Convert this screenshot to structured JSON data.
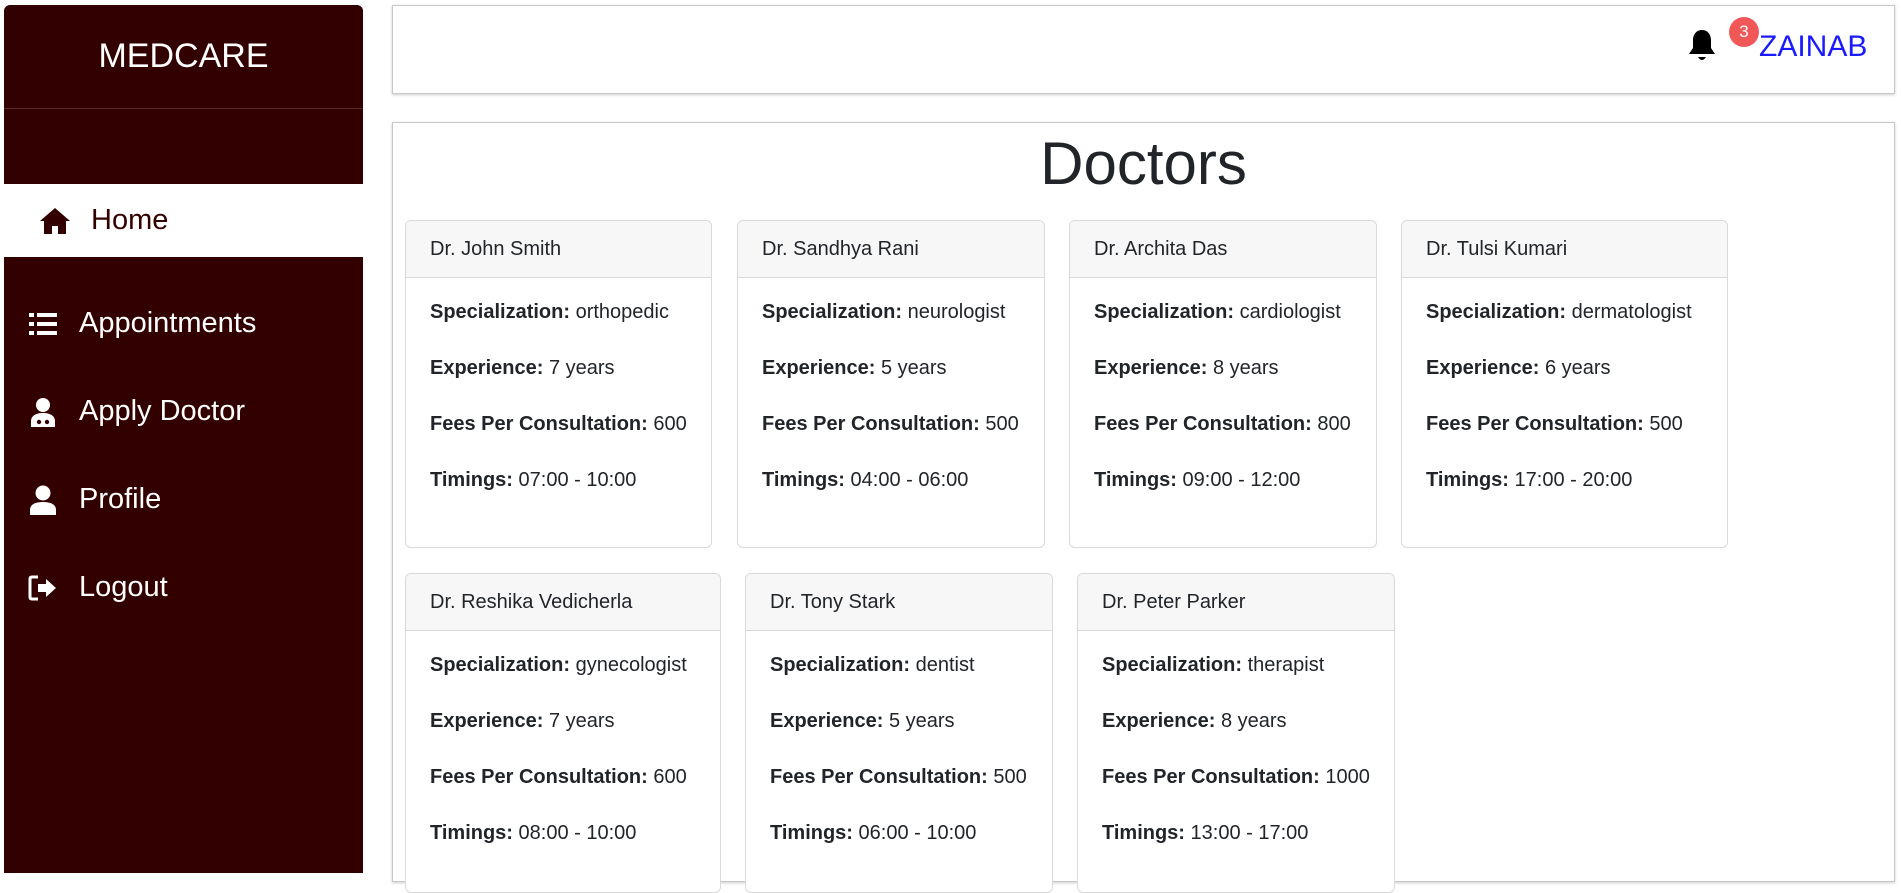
{
  "sidebar": {
    "brand": "MEDCARE",
    "items": [
      {
        "label": "Home",
        "icon": "home-icon"
      },
      {
        "label": "Appointments",
        "icon": "list-icon"
      },
      {
        "label": "Apply Doctor",
        "icon": "doctor-icon"
      },
      {
        "label": "Profile",
        "icon": "user-icon"
      },
      {
        "label": "Logout",
        "icon": "logout-icon"
      }
    ]
  },
  "header": {
    "notification_count": "3",
    "username": "ZAINAB"
  },
  "main": {
    "title": "Doctors",
    "field_labels": {
      "specialization": "Specialization:",
      "experience": "Experience:",
      "fees": "Fees Per Consultation:",
      "timings": "Timings:"
    },
    "doctors": [
      {
        "name": "Dr. John Smith",
        "specialization": "orthopedic",
        "experience": "7 years",
        "fees": "600",
        "timings": "07:00 - 10:00"
      },
      {
        "name": "Dr. Sandhya Rani",
        "specialization": "neurologist",
        "experience": "5 years",
        "fees": "500",
        "timings": "04:00 - 06:00"
      },
      {
        "name": "Dr. Archita Das",
        "specialization": "cardiologist",
        "experience": "8 years",
        "fees": "800",
        "timings": "09:00 - 12:00"
      },
      {
        "name": "Dr. Tulsi Kumari",
        "specialization": "dermatologist",
        "experience": "6 years",
        "fees": "500",
        "timings": "17:00 - 20:00"
      },
      {
        "name": "Dr. Reshika Vedicherla",
        "specialization": "gynecologist",
        "experience": "7 years",
        "fees": "600",
        "timings": "08:00 - 10:00"
      },
      {
        "name": "Dr. Tony Stark",
        "specialization": "dentist",
        "experience": "5 years",
        "fees": "500",
        "timings": "06:00 - 10:00"
      },
      {
        "name": "Dr. Peter Parker",
        "specialization": "therapist",
        "experience": "8 years",
        "fees": "1000",
        "timings": "13:00 - 17:00"
      }
    ]
  },
  "colors": {
    "sidebar_bg": "#330000",
    "badge_bg": "#f25757",
    "username_color": "#1a1aff"
  }
}
